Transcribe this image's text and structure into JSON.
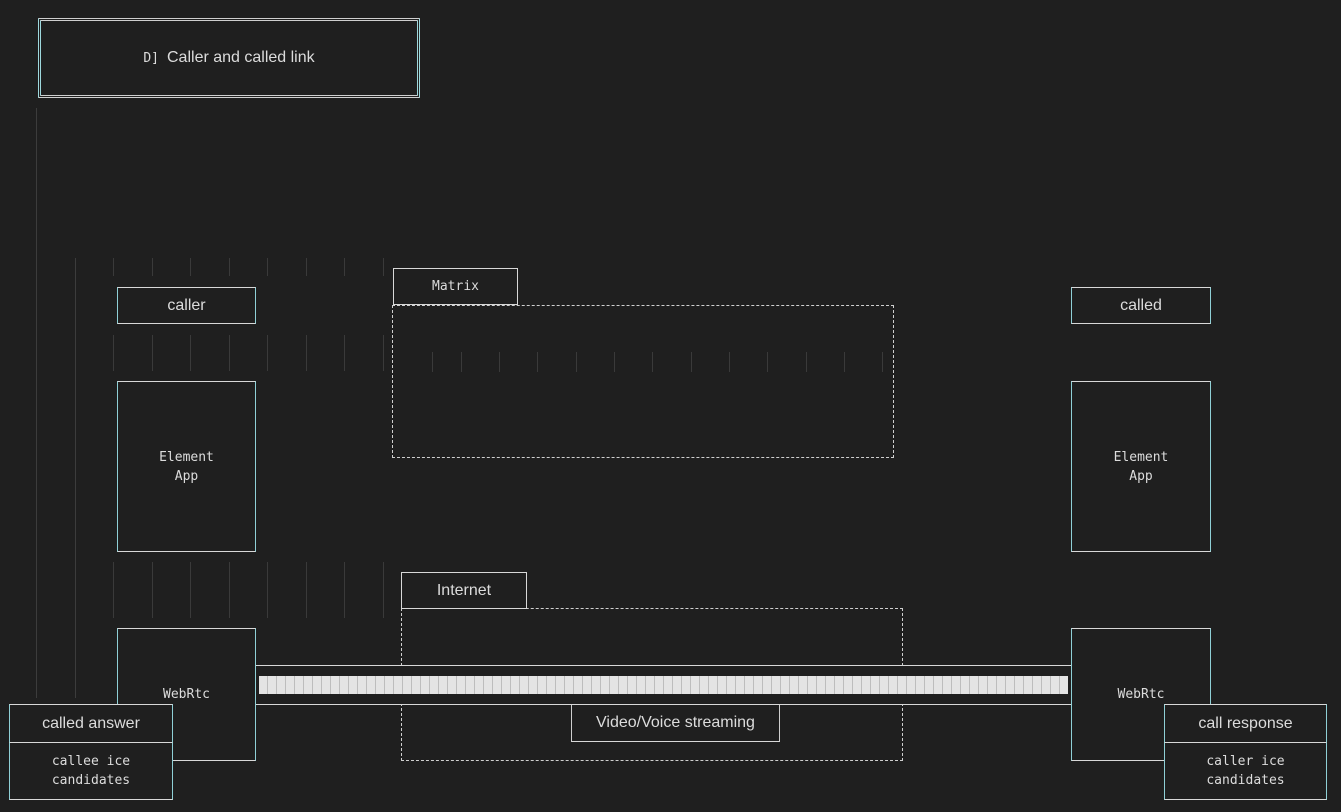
{
  "title": {
    "icon": "D]",
    "text": "Caller and called link"
  },
  "nodes": {
    "caller": "caller",
    "called": "called",
    "matrix": "Matrix",
    "internet": "Internet",
    "element_app_left": [
      "Element",
      "App"
    ],
    "element_app_right": [
      "Element",
      "App"
    ],
    "webrtc_left": "WebRtc",
    "webrtc_right": "WebRtc",
    "streaming": "Video/Voice streaming"
  },
  "notes": {
    "called_answer": {
      "header": "called answer",
      "body": [
        "callee ice",
        "candidates"
      ]
    },
    "call_response": {
      "header": "call response",
      "body": [
        "caller ice",
        "candidates"
      ]
    }
  }
}
